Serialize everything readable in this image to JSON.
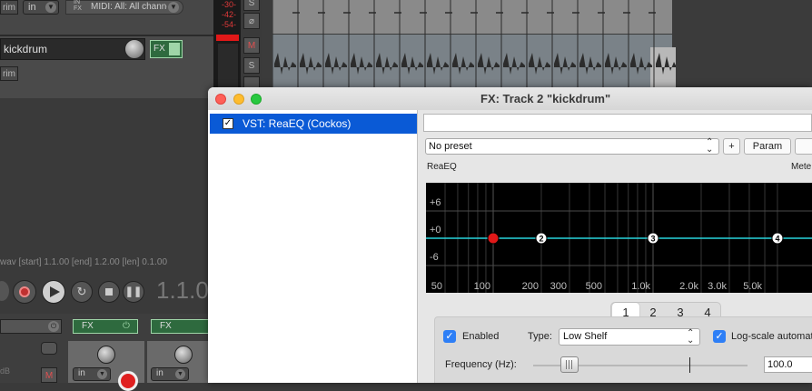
{
  "daw": {
    "track_in_label": "in",
    "midi_label": "MIDI: All: All channe",
    "midi_in_fx_label": "IN\nFX",
    "trim_label": "rim",
    "trim_label2": "rim",
    "track_name": "kickdrum",
    "fx_label": "FX",
    "meter_values": [
      "-30-",
      "-42-",
      "-54-"
    ],
    "ms_buttons": {
      "solo": "S",
      "mute": "M"
    },
    "status_text": "wav [start] 1.1.00 [end] 1.2.00 [len] 0.1.00",
    "time_display": "1.1.0",
    "mixer_fx_labels": [
      "FX",
      "FX"
    ],
    "mixer_in_labels": [
      "in",
      "in"
    ],
    "mixer_db": "dB",
    "mixer_mute": "M"
  },
  "fx_window": {
    "title": "FX: Track 2 \"kickdrum\"",
    "chain": [
      {
        "label": "VST: ReaEQ (Cockos)",
        "enabled": true,
        "selected": true
      }
    ],
    "preset": "No preset",
    "add_btn": "+",
    "param_btn": "Param",
    "plugin_name": "ReaEQ",
    "meter_label": "Mete",
    "graph": {
      "y_labels": [
        "+6",
        "+0",
        "-6"
      ],
      "x_labels": [
        "50",
        "100",
        "200",
        "300",
        "500",
        "1.0k",
        "2.0k",
        "3.0k",
        "5.0k"
      ],
      "bands": [
        {
          "n": "1",
          "freq": 100,
          "active": true
        },
        {
          "n": "2",
          "freq": 200,
          "active": false
        },
        {
          "n": "3",
          "freq": 1000,
          "active": false
        },
        {
          "n": "4",
          "freq": 6000,
          "active": false
        }
      ],
      "line_color": "#28d4dc"
    },
    "tabs": [
      "1",
      "2",
      "3",
      "4"
    ],
    "selected_tab": "1",
    "enabled_label": "Enabled",
    "type_label": "Type:",
    "type_value": "Low Shelf",
    "log_scale_label": "Log-scale automat",
    "frequency_label": "Frequency (Hz):",
    "frequency_value": "100.0"
  }
}
